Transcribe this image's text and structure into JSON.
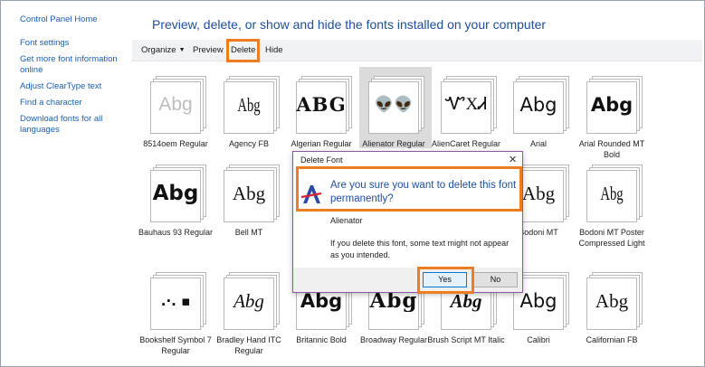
{
  "sidebar": {
    "home": "Control Panel Home",
    "links": [
      "Font settings",
      "Get more font information online",
      "Adjust ClearType text",
      "Find a character",
      "Download fonts for all languages"
    ]
  },
  "header": {
    "title": "Preview, delete, or show and hide the fonts installed on your computer"
  },
  "toolbar": {
    "organize": "Organize",
    "preview": "Preview",
    "delete": "Delete",
    "hide": "Hide"
  },
  "fonts": [
    {
      "sample": "Abg",
      "name": "8514oem Regular"
    },
    {
      "sample": "Abg",
      "name": "Agency FB"
    },
    {
      "sample": "ABG",
      "name": "Algerian Regular"
    },
    {
      "sample": "👽👽",
      "name": "Alienator Regular",
      "selected": true
    },
    {
      "sample": "ᏉXᏗ",
      "name": "AlienCaret Regular"
    },
    {
      "sample": "Abg",
      "name": "Arial"
    },
    {
      "sample": "Abg",
      "name": "Arial Rounded MT Bold"
    },
    {
      "sample": "Abg",
      "name": "Bauhaus 93 Regular"
    },
    {
      "sample": "Abg",
      "name": "Bell MT"
    },
    {
      "sample": "Abg",
      "name": "Bodoni MT"
    },
    {
      "sample": "Abg",
      "name": "Bodoni MT Poster Compressed Light"
    },
    {
      "sample": ".·. ▪",
      "name": "Bookshelf Symbol 7 Regular"
    },
    {
      "sample": "Abg",
      "name": "Bradley Hand ITC Regular"
    },
    {
      "sample": "Abg",
      "name": "Britannic Bold"
    },
    {
      "sample": "Abg",
      "name": "Broadway Regular"
    },
    {
      "sample": "Abg",
      "name": "Brush Script MT Italic"
    },
    {
      "sample": "Abg",
      "name": "Calibri"
    },
    {
      "sample": "Abg",
      "name": "Californian FB"
    }
  ],
  "dialog": {
    "title": "Delete Font",
    "close": "✕",
    "question": "Are you sure you want to delete this font permanently?",
    "font_name": "Alienator",
    "warning": "If you delete this font, some text might not appear as you intended.",
    "yes": "Yes",
    "no": "No"
  },
  "colors": {
    "highlight": "#ee7d22",
    "link": "#1a5fb4",
    "title": "#1f4e9c",
    "dialog_border": "#8f56a3"
  }
}
